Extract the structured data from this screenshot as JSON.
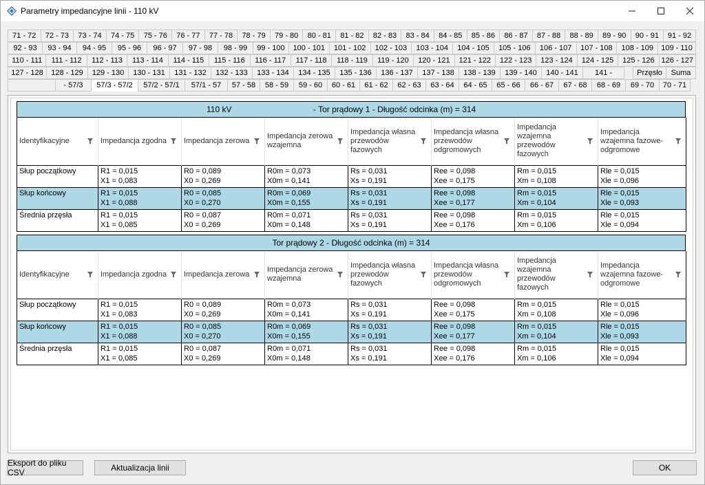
{
  "window": {
    "title": "Parametry impedancyjne linii - 110 kV"
  },
  "tab_rows": [
    [
      "71 - 72",
      "72 - 73",
      "73 - 74",
      "74 - 75",
      "75 - 76",
      "76 - 77",
      "77 - 78",
      "78 - 79",
      "79 - 80",
      "80 - 81",
      "81 - 82",
      "82 - 83",
      "83 - 84",
      "84 - 85",
      "85 - 86",
      "86 - 87",
      "87 - 88",
      "88 - 89",
      "89 - 90",
      "90 - 91",
      "91 - 92"
    ],
    [
      "92 - 93",
      "93 - 94",
      "94 - 95",
      "95 - 96",
      "96 - 97",
      "97 - 98",
      "98 - 99",
      "99 - 100",
      "100 - 101",
      "101 - 102",
      "102 - 103",
      "103 - 104",
      "104 - 105",
      "105 - 106",
      "106 - 107",
      "107 - 108",
      "108 - 109",
      "109 - 110"
    ],
    [
      "110 - 111",
      "111 - 112",
      "112 - 113",
      "113 - 114",
      "114 - 115",
      "115 - 116",
      "116 - 117",
      "117 - 118",
      "118 - 119",
      "119 - 120",
      "120 - 121",
      "121 - 122",
      "122 - 123",
      "123 - 124",
      "124 - 125",
      "125 - 126",
      "126 - 127"
    ],
    [
      "127 - 128",
      "128 - 129",
      "129 - 130",
      "130 - 131",
      "131 - 132",
      "132 - 133",
      "133 - 134",
      "134 - 135",
      "135 - 136",
      "136 - 137",
      "137 - 138",
      "138 - 139",
      "139 - 140",
      "140 - 141",
      "141 -"
    ],
    [
      "",
      "- 57/3",
      "57/3 - 57/2",
      "57/2 - 57/1",
      "57/1 - 57",
      "57 - 58",
      "58 - 59",
      "59 - 60",
      "60 - 61",
      "61 - 62",
      "62 - 63",
      "63 - 64",
      "64 - 65",
      "65 - 66",
      "66 - 67",
      "67 - 68",
      "68 - 69",
      "69 - 70",
      "70 - 71"
    ]
  ],
  "tab_row4_right": [
    "Przęsło",
    "Suma"
  ],
  "active_tab": "57/3 - 57/2",
  "columns": [
    "Identyfikacyjne",
    "Impedancja zgodna",
    "Impedancja zerowa",
    "Impedancja zerowa wzajemna",
    "Impedancja własna przewodów fazowych",
    "Impedancja własna przewodów odgromowych",
    "Impedancja wzajemna przewodów fazowych",
    "Impedancja wzajemna fazowe-odgromowe"
  ],
  "sections": [
    {
      "voltage": "110 kV",
      "header": "- Tor prądowy 1 - Długość odcinka (m) = 314",
      "rows": [
        {
          "id": "Słup początkowy",
          "cells": [
            [
              "R1 = 0,015",
              "X1 = 0,083"
            ],
            [
              "R0 = 0,089",
              "X0 = 0,269"
            ],
            [
              "R0m = 0,073",
              "X0m = 0,141"
            ],
            [
              "Rs = 0,031",
              "Xs = 0,191"
            ],
            [
              "Ree = 0,098",
              "Xee = 0,175"
            ],
            [
              "Rm = 0,015",
              "Xm = 0,108"
            ],
            [
              "Rle = 0,015",
              "Xle = 0,096"
            ]
          ]
        },
        {
          "id": "Słup końcowy",
          "cells": [
            [
              "R1 = 0,015",
              "X1 = 0,088"
            ],
            [
              "R0 = 0,085",
              "X0 = 0,270"
            ],
            [
              "R0m = 0,069",
              "X0m = 0,155"
            ],
            [
              "Rs = 0,031",
              "Xs = 0,191"
            ],
            [
              "Ree = 0,098",
              "Xee = 0,177"
            ],
            [
              "Rm = 0,015",
              "Xm = 0,104"
            ],
            [
              "Rle = 0,015",
              "Xle = 0,093"
            ]
          ]
        },
        {
          "id": "Średnia przęsła",
          "cells": [
            [
              "R1 = 0,015",
              "X1 = 0,085"
            ],
            [
              "R0 = 0,087",
              "X0 = 0,269"
            ],
            [
              "R0m = 0,071",
              "X0m = 0,148"
            ],
            [
              "Rs = 0,031",
              "Xs = 0,191"
            ],
            [
              "Ree = 0,098",
              "Xee = 0,176"
            ],
            [
              "Rm = 0,015",
              "Xm = 0,106"
            ],
            [
              "Rle = 0,015",
              "Xle = 0,094"
            ]
          ]
        }
      ]
    },
    {
      "voltage": "",
      "header": "Tor prądowy 2 - Długość odcinka (m) = 314",
      "rows": [
        {
          "id": "Słup początkowy",
          "cells": [
            [
              "R1 = 0,015",
              "X1 = 0,083"
            ],
            [
              "R0 = 0,089",
              "X0 = 0,269"
            ],
            [
              "R0m = 0,073",
              "X0m = 0,141"
            ],
            [
              "Rs = 0,031",
              "Xs = 0,191"
            ],
            [
              "Ree = 0,098",
              "Xee = 0,175"
            ],
            [
              "Rm = 0,015",
              "Xm = 0,108"
            ],
            [
              "Rle = 0,015",
              "Xle = 0,096"
            ]
          ]
        },
        {
          "id": "Słup końcowy",
          "cells": [
            [
              "R1 = 0,015",
              "X1 = 0,088"
            ],
            [
              "R0 = 0,085",
              "X0 = 0,270"
            ],
            [
              "R0m = 0,069",
              "X0m = 0,155"
            ],
            [
              "Rs = 0,031",
              "Xs = 0,191"
            ],
            [
              "Ree = 0,098",
              "Xee = 0,177"
            ],
            [
              "Rm = 0,015",
              "Xm = 0,104"
            ],
            [
              "Rle = 0,015",
              "Xle = 0,093"
            ]
          ]
        },
        {
          "id": "Średnia przęsła",
          "cells": [
            [
              "R1 = 0,015",
              "X1 = 0,085"
            ],
            [
              "R0 = 0,087",
              "X0 = 0,269"
            ],
            [
              "R0m = 0,071",
              "X0m = 0,148"
            ],
            [
              "Rs = 0,031",
              "Xs = 0,191"
            ],
            [
              "Ree = 0,098",
              "Xee = 0,176"
            ],
            [
              "Rm = 0,015",
              "Xm = 0,106"
            ],
            [
              "Rle = 0,015",
              "Xle = 0,094"
            ]
          ]
        }
      ]
    }
  ],
  "selected_row_index": 1,
  "buttons": {
    "export": "Eksport do pliku CSV",
    "update": "Aktualizacja linii",
    "ok": "OK"
  },
  "colors": {
    "selection": "#add8e6",
    "header_band": "#add8e6",
    "app_icon": "#2f6fb5"
  },
  "icons": {
    "app": "diamond-app-icon",
    "filter": "filter-icon",
    "minimize": "minimize-icon",
    "maximize": "maximize-icon",
    "close": "close-icon"
  }
}
